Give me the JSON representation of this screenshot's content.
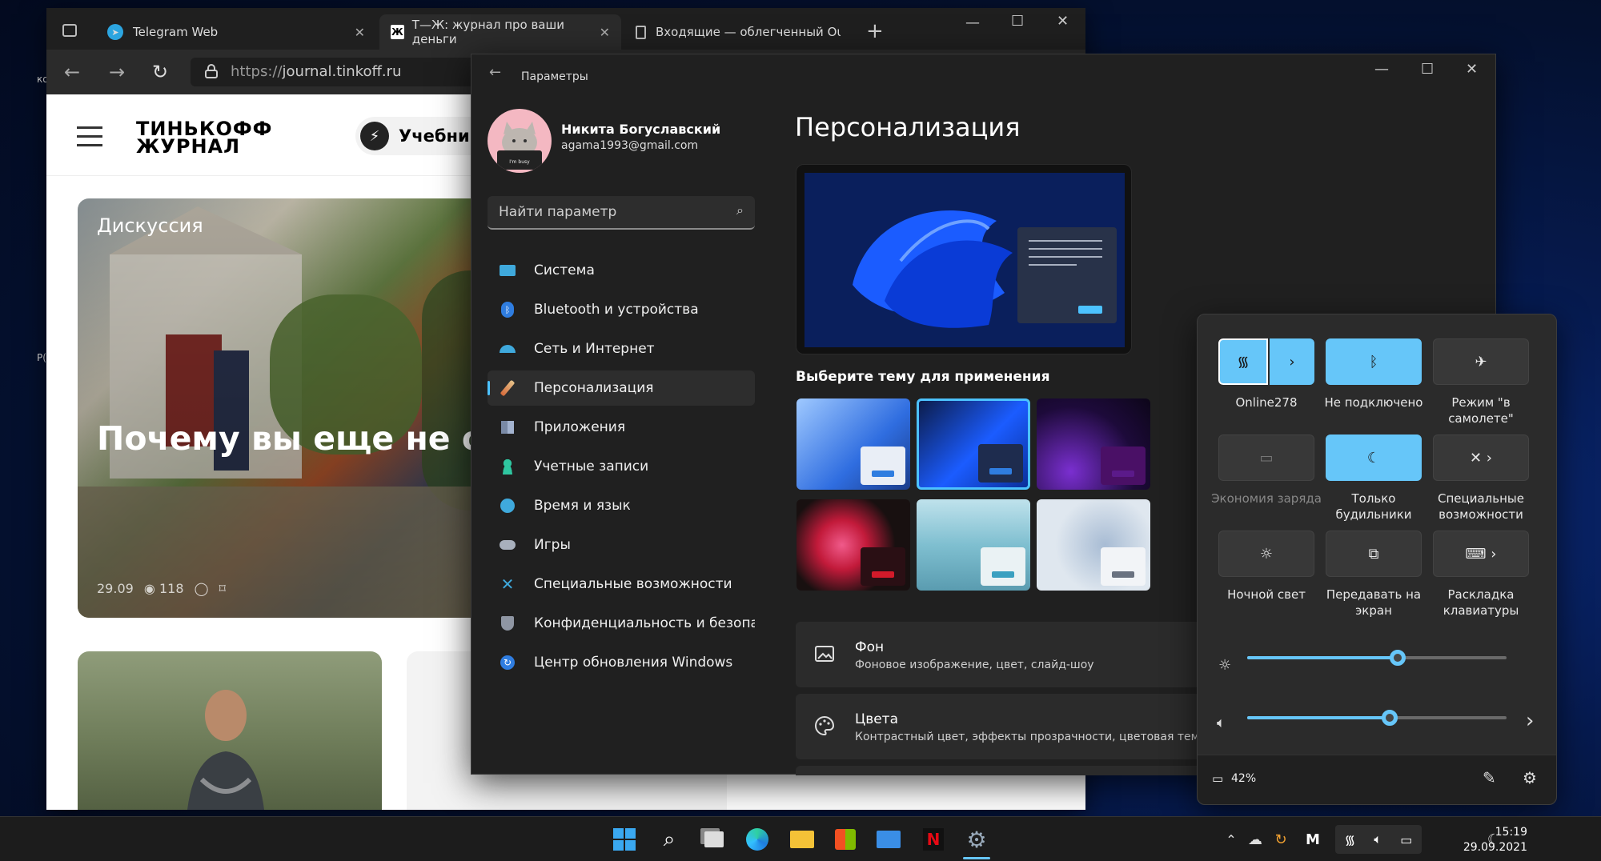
{
  "browser": {
    "tabs": [
      {
        "label": "Telegram Web"
      },
      {
        "label": "Т—Ж: журнал про ваши деньги"
      },
      {
        "label": "Входящие — облегченный Out"
      }
    ],
    "url_scheme": "https://",
    "url_host": "journal.tinkoff.ru",
    "page": {
      "logo_line1": "ТИНЬКОФФ",
      "logo_line2": "ЖУРНАЛ",
      "nav_button": "Учебник",
      "card1": {
        "tag": "Дискуссия",
        "title": "Почему вы еще не от",
        "date": "29.09",
        "views": "118"
      }
    }
  },
  "settings": {
    "window_title": "Параметры",
    "user_name": "Никита Богуславский",
    "user_email": "agama1993@gmail.com",
    "avatar_caption": "I'm busy",
    "search_placeholder": "Найти параметр",
    "nav": [
      {
        "label": "Система",
        "icon": "system-icon"
      },
      {
        "label": "Bluetooth и устройства",
        "icon": "bluetooth-icon"
      },
      {
        "label": "Сеть и Интернет",
        "icon": "network-icon"
      },
      {
        "label": "Персонализация",
        "icon": "brush-icon",
        "selected": true
      },
      {
        "label": "Приложения",
        "icon": "apps-icon"
      },
      {
        "label": "Учетные записи",
        "icon": "account-icon"
      },
      {
        "label": "Время и язык",
        "icon": "time-language-icon"
      },
      {
        "label": "Игры",
        "icon": "gamepad-icon"
      },
      {
        "label": "Специальные возможности",
        "icon": "accessibility-icon"
      },
      {
        "label": "Конфиденциальность и безопас",
        "icon": "shield-icon"
      },
      {
        "label": "Центр обновления Windows",
        "icon": "update-icon"
      }
    ],
    "page_title": "Персонализация",
    "themes_heading": "Выберите тему для применения",
    "rows": [
      {
        "title": "Фон",
        "subtitle": "Фоновое изображение, цвет, слайд-шоу",
        "icon": "image-icon"
      },
      {
        "title": "Цвета",
        "subtitle": "Контрастный цвет, эффекты прозрачности, цветовая тема",
        "icon": "palette-icon"
      }
    ],
    "accent": "#4cc2ff"
  },
  "quick_settings": {
    "tiles": [
      {
        "label": "Online278",
        "icon": "wifi-icon",
        "state": "on"
      },
      {
        "label": "Не подключено",
        "icon": "bluetooth-icon",
        "state": "on"
      },
      {
        "label": "Режим \"в самолете\"",
        "icon": "airplane-icon",
        "state": "off"
      },
      {
        "label": "Экономия заряда",
        "icon": "battery-saver-icon",
        "state": "disabled"
      },
      {
        "label": "Только будильники",
        "icon": "moon-icon",
        "state": "on"
      },
      {
        "label": "Специальные возможности",
        "icon": "accessibility-icon",
        "state": "off"
      },
      {
        "label": "Ночной свет",
        "icon": "sun-icon",
        "state": "off"
      },
      {
        "label": "Передавать на экран",
        "icon": "cast-icon",
        "state": "off"
      },
      {
        "label": "Раскладка клавиатуры",
        "icon": "keyboard-icon",
        "state": "off"
      }
    ],
    "brightness_level": 0.58,
    "volume_level": 0.55,
    "battery": "42%",
    "accent": "#66c6f9"
  },
  "taskbar": {
    "time": "15:19",
    "date": "29.09.2021"
  },
  "desktop": {
    "labels": [
      "ко",
      "Р("
    ]
  }
}
